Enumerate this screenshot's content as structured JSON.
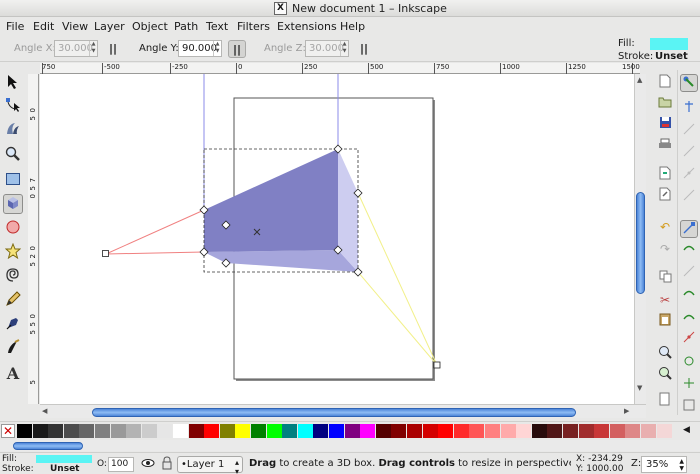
{
  "window": {
    "title": "New document 1 – Inkscape",
    "app_icon": "X"
  },
  "menu": [
    "File",
    "Edit",
    "View",
    "Layer",
    "Object",
    "Path",
    "Text",
    "Filters",
    "Extensions",
    "Help"
  ],
  "tool_controls": {
    "angle_x_label": "Angle X:",
    "angle_x_value": "30.000",
    "angle_y_label": "Angle Y:",
    "angle_y_value": "90.000",
    "angle_z_label": "Angle Z:",
    "angle_z_value": "30.000",
    "pause_glyph": "||"
  },
  "style_indicator": {
    "fill_label": "Fill:",
    "stroke_label": "Stroke:",
    "stroke_value": "Unset",
    "fill_color": "#5af4f4"
  },
  "ruler": {
    "h_labels": [
      "750",
      "-500",
      "-250",
      "0",
      "250",
      "500",
      "750",
      "1000",
      "1250",
      "1500"
    ],
    "v_labels": [
      "0",
      "5",
      "7",
      "5",
      "0",
      "0",
      "2",
      "5",
      "0",
      "0",
      "5",
      "5",
      "0",
      "0",
      "7",
      "5",
      "0",
      "1",
      "0",
      "0",
      "0"
    ]
  },
  "tools": [
    "selector",
    "node",
    "tweak",
    "zoom",
    "rect",
    "3dbox",
    "ellipse",
    "star",
    "spiral",
    "pencil",
    "pen",
    "calligraphy",
    "text"
  ],
  "palette": [
    "#000000",
    "#1a1a1a",
    "#333333",
    "#4d4d4d",
    "#666666",
    "#808080",
    "#999999",
    "#b3b3b3",
    "#cccccc",
    "#e6e6e6",
    "#ffffff",
    "#800000",
    "#ff0000",
    "#808000",
    "#ffff00",
    "#008000",
    "#00ff00",
    "#008080",
    "#00ffff",
    "#000080",
    "#0000ff",
    "#800080",
    "#ff00ff",
    "#550000",
    "#800000",
    "#aa0000",
    "#d40000",
    "#ff0000",
    "#ff2a2a",
    "#ff5555",
    "#ff8080",
    "#ffaaaa",
    "#ffd5d5",
    "#280b0b",
    "#501616",
    "#782121",
    "#a02c2c",
    "#c83737",
    "#d35f5f",
    "#de8787",
    "#e9afaf",
    "#f4d7d7"
  ],
  "status": {
    "fill_label": "Fill:",
    "stroke_label": "Stroke:",
    "stroke_value": "Unset",
    "opacity_label": "O:",
    "opacity_value": "100",
    "layer": "•Layer 1",
    "message_bold1": "Drag",
    "message_text1": " to create a 3D box. ",
    "message_bold2": "Drag controls",
    "message_text2": " to resize in perspective. ",
    "x_label": "X:",
    "x_value": "-234.29",
    "y_label": "Y:",
    "y_value": "1000.00",
    "z_label": "Z:",
    "zoom_value": "35%"
  }
}
